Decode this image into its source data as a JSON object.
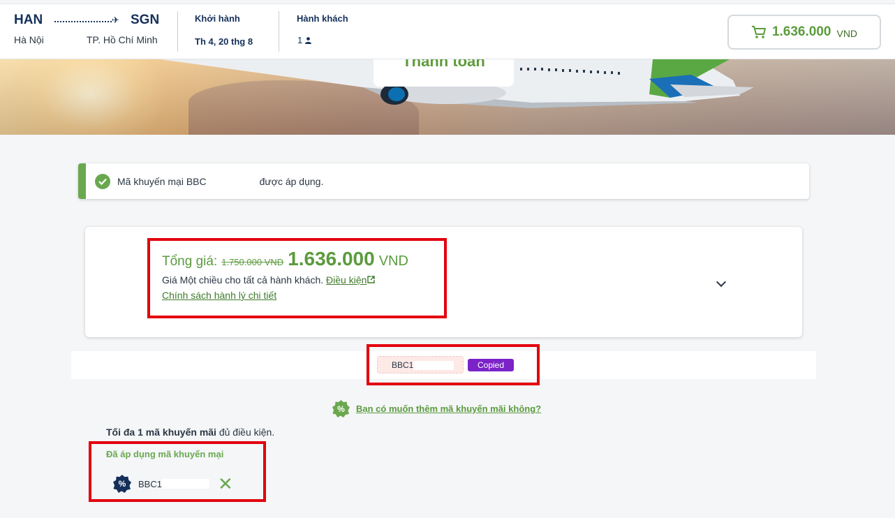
{
  "header": {
    "origin_code": "HAN",
    "origin_city": "Hà Nội",
    "dest_code": "SGN",
    "dest_city": "TP. Hồ Chí Minh",
    "departure_label": "Khởi hành",
    "departure_value": "Th 4, 20 thg 8",
    "passengers_label": "Hành khách",
    "passengers_value": "1",
    "cart_amount": "1.636.000",
    "cart_currency": "VND"
  },
  "banner": {
    "title": "Thanh toán"
  },
  "alert": {
    "text_before": "Mã khuyến mại BBC",
    "text_after": "được áp dụng."
  },
  "price": {
    "label": "Tổng giá:",
    "old_price": "1.750.000 VND",
    "new_price": "1.636.000",
    "currency": "VND",
    "note": "Giá Một chiều cho tất cả hành khách.",
    "conditions_link": "Điều kiện",
    "baggage_link": "Chính sách hành lý chi tiết"
  },
  "code_chip": {
    "code_visible": "BBC1",
    "copied_badge": "Copied"
  },
  "promo": {
    "add_link": "Bạn có muốn thêm mã khuyến mãi không?",
    "max_bold": "Tối đa 1 mã khuyến mãi",
    "max_rest": "đủ điều kiện.",
    "applied_title": "Đã áp dụng mã khuyến mại",
    "applied_code": "BBC1"
  },
  "colors": {
    "brand_green": "#5b9b3d",
    "brand_navy": "#14305a",
    "highlight_red": "#e3000f",
    "badge_purple": "#7b22c8"
  },
  "icons": [
    "plane-icon",
    "person-icon",
    "cart-icon",
    "check-icon",
    "external-link-icon",
    "chevron-down-icon",
    "percent-badge-icon",
    "remove-icon"
  ]
}
